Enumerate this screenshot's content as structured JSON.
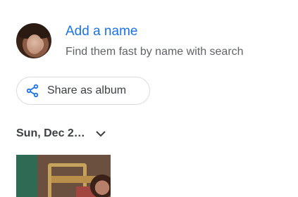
{
  "person": {
    "add_name_label": "Add a name",
    "subtitle": "Find them fast by name with search"
  },
  "share": {
    "label": "Share as album",
    "icon": "share-icon"
  },
  "date_section": {
    "label": "Sun, Dec 2…",
    "icon": "chevron-down-icon"
  },
  "colors": {
    "accent": "#1a73e8",
    "text": "#3c4043",
    "muted": "#5f6368"
  }
}
